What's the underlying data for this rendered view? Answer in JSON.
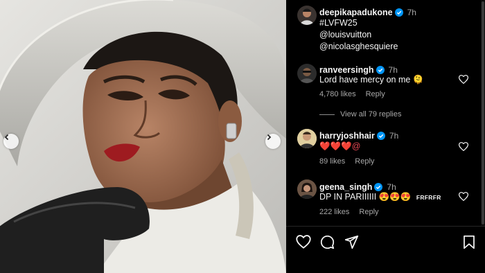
{
  "post": {
    "author": "deepikapadukone",
    "timestamp": "7h",
    "caption_lines": [
      "#LVFW25",
      "@louisvuitton",
      "@nicolasghesquiere"
    ]
  },
  "comments": [
    {
      "username": "ranveersingh",
      "timestamp": "7h",
      "text": "Lord have mercy on me 🫠",
      "likes": "4,780 likes",
      "reply_label": "Reply",
      "view_replies": "View all 79 replies"
    },
    {
      "username": "harryjoshhair",
      "timestamp": "7h",
      "text": "❤️❤️❤️@",
      "likes": "89 likes",
      "reply_label": "Reply"
    },
    {
      "username": "geena_singh",
      "timestamp": "7h",
      "text": "DP IN PARIIIIII 😍😍😍",
      "tag": "FRFRFR",
      "likes": "222 likes",
      "reply_label": "Reply"
    }
  ],
  "actions": [
    "heart-icon",
    "comment-icon",
    "share-icon",
    "bookmark-icon"
  ],
  "icons": {
    "carousel_prev": "chevron-left-icon",
    "carousel_next": "chevron-right-icon",
    "verified": "verified-badge-icon"
  },
  "colors": {
    "background": "#000000",
    "verified": "#0095f6",
    "secondary_text": "#a8a8a8",
    "heart_emoji": "#ed4956"
  }
}
